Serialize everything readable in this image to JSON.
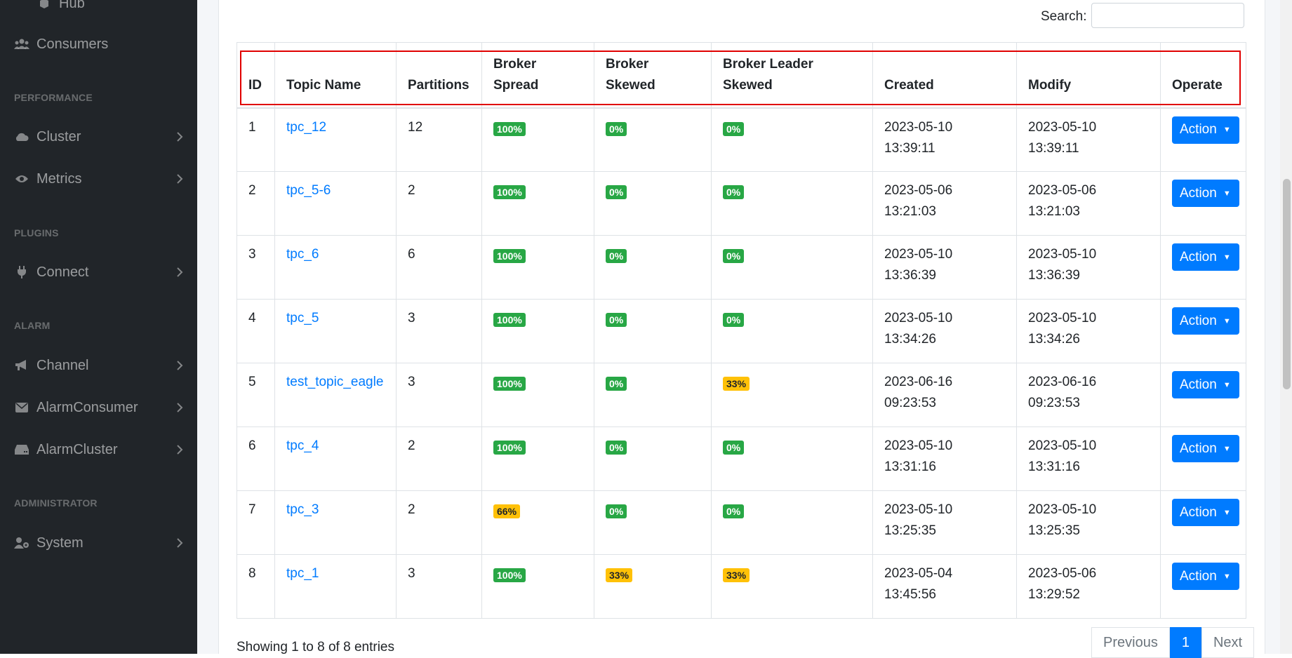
{
  "sidebar": {
    "top_item": "Hub",
    "consumers": "Consumers",
    "headings": {
      "performance": "PERFORMANCE",
      "plugins": "PLUGINS",
      "alarm": "ALARM",
      "administrator": "ADMINISTRATOR"
    },
    "items": {
      "cluster": "Cluster",
      "metrics": "Metrics",
      "connect": "Connect",
      "channel": "Channel",
      "alarm_consumer": "AlarmConsumer",
      "alarm_cluster": "AlarmCluster",
      "system": "System"
    }
  },
  "search": {
    "label": "Search:",
    "value": ""
  },
  "table": {
    "headers": {
      "id": "ID",
      "topic_name": "Topic Name",
      "partitions": "Partitions",
      "broker_spread": "Broker Spread",
      "broker_skewed": "Broker Skewed",
      "broker_leader_skewed": "Broker Leader Skewed",
      "created": "Created",
      "modify": "Modify",
      "operate": "Operate"
    },
    "action_label": "Action",
    "rows": [
      {
        "id": "1",
        "topic": "tpc_12",
        "partitions": "12",
        "spread": "100%",
        "skewed": "0%",
        "leader_skewed": "0%",
        "created_date": "2023-05-10",
        "created_time": "13:39:11",
        "modify_date": "2023-05-10",
        "modify_time": "13:39:11"
      },
      {
        "id": "2",
        "topic": "tpc_5-6",
        "partitions": "2",
        "spread": "100%",
        "skewed": "0%",
        "leader_skewed": "0%",
        "created_date": "2023-05-06",
        "created_time": "13:21:03",
        "modify_date": "2023-05-06",
        "modify_time": "13:21:03"
      },
      {
        "id": "3",
        "topic": "tpc_6",
        "partitions": "6",
        "spread": "100%",
        "skewed": "0%",
        "leader_skewed": "0%",
        "created_date": "2023-05-10",
        "created_time": "13:36:39",
        "modify_date": "2023-05-10",
        "modify_time": "13:36:39"
      },
      {
        "id": "4",
        "topic": "tpc_5",
        "partitions": "3",
        "spread": "100%",
        "skewed": "0%",
        "leader_skewed": "0%",
        "created_date": "2023-05-10",
        "created_time": "13:34:26",
        "modify_date": "2023-05-10",
        "modify_time": "13:34:26"
      },
      {
        "id": "5",
        "topic": "test_topic_eagle",
        "partitions": "3",
        "spread": "100%",
        "skewed": "0%",
        "leader_skewed": "33%",
        "created_date": "2023-06-16",
        "created_time": "09:23:53",
        "modify_date": "2023-06-16",
        "modify_time": "09:23:53"
      },
      {
        "id": "6",
        "topic": "tpc_4",
        "partitions": "2",
        "spread": "100%",
        "skewed": "0%",
        "leader_skewed": "0%",
        "created_date": "2023-05-10",
        "created_time": "13:31:16",
        "modify_date": "2023-05-10",
        "modify_time": "13:31:16"
      },
      {
        "id": "7",
        "topic": "tpc_3",
        "partitions": "2",
        "spread": "66%",
        "skewed": "0%",
        "leader_skewed": "0%",
        "created_date": "2023-05-10",
        "created_time": "13:25:35",
        "modify_date": "2023-05-10",
        "modify_time": "13:25:35"
      },
      {
        "id": "8",
        "topic": "tpc_1",
        "partitions": "3",
        "spread": "100%",
        "skewed": "33%",
        "leader_skewed": "33%",
        "created_date": "2023-05-04",
        "created_time": "13:45:56",
        "modify_date": "2023-05-06",
        "modify_time": "13:29:52"
      }
    ]
  },
  "footer": {
    "info": "Showing 1 to 8 of 8 entries",
    "previous": "Previous",
    "page": "1",
    "next": "Next"
  },
  "colors": {
    "sidebar_bg": "#212529",
    "accent": "#007bff",
    "badge_green": "#28a745",
    "badge_yellow": "#ffc107",
    "highlight": "#e00000"
  }
}
